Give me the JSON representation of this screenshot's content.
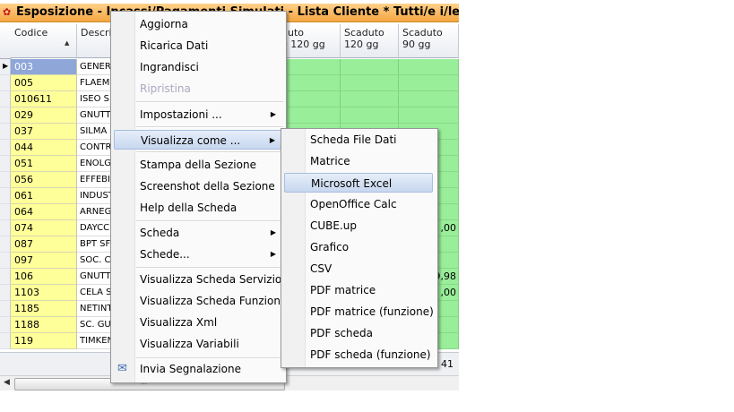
{
  "window": {
    "title": "Esposizione - Incassi/Pagamenti Simulati - Lista Cliente * Tutti/e i/le"
  },
  "grid": {
    "headers": {
      "codice": "Codice",
      "descrizione": "Descriz",
      "scaduto_oltre_120": "duto\ne 120 gg",
      "scaduto_120": "Scaduto\n120 gg",
      "scaduto_90": "Scaduto\n90 gg"
    },
    "rows": [
      {
        "code": "003",
        "desc": "GENER",
        "val": ""
      },
      {
        "code": "005",
        "desc": "FLAEM",
        "val": ""
      },
      {
        "code": "010611",
        "desc": "ISEO S",
        "val": ""
      },
      {
        "code": "029",
        "desc": "GNUTT",
        "val": ""
      },
      {
        "code": "037",
        "desc": "SILMA",
        "val": ""
      },
      {
        "code": "044",
        "desc": "CONTR",
        "val": ""
      },
      {
        "code": "051",
        "desc": "ENOLG",
        "val": ""
      },
      {
        "code": "056",
        "desc": "EFFEBI",
        "val": ""
      },
      {
        "code": "061",
        "desc": "INDUST",
        "val": ""
      },
      {
        "code": "064",
        "desc": "ARNEG",
        "val": ""
      },
      {
        "code": "074",
        "desc": "DAYCC",
        "val": ",00"
      },
      {
        "code": "087",
        "desc": "BPT SF",
        "val": ""
      },
      {
        "code": "097",
        "desc": "SOC. C",
        "val": ""
      },
      {
        "code": "106",
        "desc": "GNUTT",
        "val": "9,98"
      },
      {
        "code": "1103",
        "desc": "CELA S",
        "val": ",00"
      },
      {
        "code": "1185",
        "desc": "NETINT",
        "val": ""
      },
      {
        "code": "1188",
        "desc": "SC. GU",
        "val": ""
      },
      {
        "code": "119",
        "desc": "TIMKEN",
        "val": ""
      }
    ],
    "footer_count": "41",
    "scroll_grip": "III"
  },
  "context_menu": {
    "items": [
      {
        "label": "Aggiorna"
      },
      {
        "label": "Ricarica Dati"
      },
      {
        "label": "Ingrandisci"
      },
      {
        "label": "Ripristina"
      },
      {
        "label": "Impostazioni ..."
      },
      {
        "label": "Visualizza come ..."
      },
      {
        "label": "Stampa della Sezione"
      },
      {
        "label": "Screenshot della Sezione"
      },
      {
        "label": "Help della Scheda"
      },
      {
        "label": "Scheda"
      },
      {
        "label": "Schede..."
      },
      {
        "label": "Visualizza Scheda Servizio"
      },
      {
        "label": "Visualizza Scheda Funzione"
      },
      {
        "label": "Visualizza Xml"
      },
      {
        "label": "Visualizza Variabili"
      },
      {
        "label": "Invia Segnalazione"
      }
    ]
  },
  "submenu": {
    "items": [
      {
        "label": "Scheda File Dati"
      },
      {
        "label": "Matrice"
      },
      {
        "label": "Microsoft Excel"
      },
      {
        "label": "OpenOffice Calc"
      },
      {
        "label": "CUBE.up"
      },
      {
        "label": "Grafico"
      },
      {
        "label": "CSV"
      },
      {
        "label": "PDF matrice"
      },
      {
        "label": "PDF matrice (funzione)"
      },
      {
        "label": "PDF scheda"
      },
      {
        "label": "PDF scheda (funzione)"
      }
    ]
  },
  "colors": {
    "title_bar": "#f5a642",
    "code_column": "#ffff9a",
    "green_cells": "#99ee99",
    "selected_row": "#8ea6d8",
    "menu_highlight": "#c7d7ef"
  }
}
